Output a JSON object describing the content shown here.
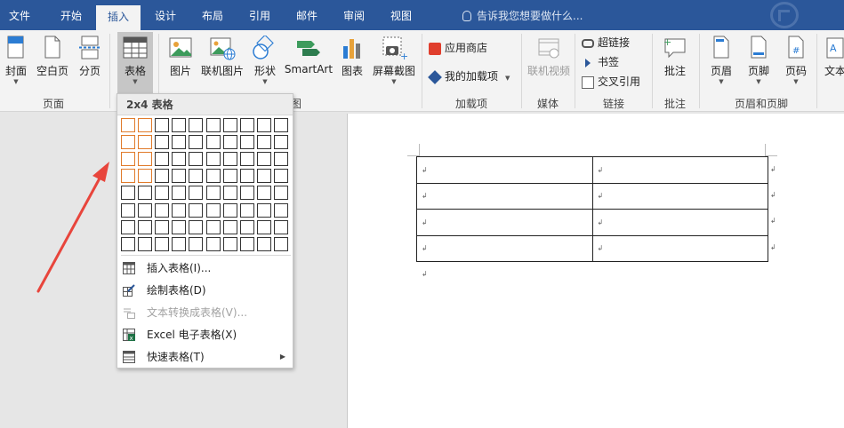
{
  "tabs": [
    "文件",
    "开始",
    "插入",
    "设计",
    "布局",
    "引用",
    "邮件",
    "审阅",
    "视图"
  ],
  "active_tab": "插入",
  "tell_me_placeholder": "告诉我您想要做什么...",
  "ribbon": {
    "pages_group": {
      "label": "页面",
      "cover": "封面",
      "blank_page": "空白页",
      "page_break": "分页"
    },
    "table_button": "表格",
    "illustrations": {
      "picture": "图片",
      "online_picture": "联机图片",
      "shapes": "形状",
      "smartart": "SmartArt",
      "chart": "图表",
      "screenshot": "屏幕截图",
      "group_label_tail": "图"
    },
    "addins": {
      "label": "加载项",
      "store": "应用商店",
      "my_addins": "我的加载项"
    },
    "media": {
      "label": "媒体",
      "online_video": "联机视频"
    },
    "links": {
      "label": "链接",
      "hyperlink": "超链接",
      "bookmark": "书签",
      "cross_ref": "交叉引用"
    },
    "comments": {
      "label": "批注",
      "comment": "批注"
    },
    "header_footer": {
      "label": "页眉和页脚",
      "header": "页眉",
      "footer": "页脚",
      "page_number": "页码"
    },
    "text_box": "文本"
  },
  "table_dropdown": {
    "header": "2x4 表格",
    "selected_cols": 2,
    "selected_rows": 4,
    "grid_cols": 10,
    "grid_rows": 8,
    "items": [
      {
        "label": "插入表格(I)...",
        "disabled": false
      },
      {
        "label": "绘制表格(D)",
        "disabled": false
      },
      {
        "label": "文本转换成表格(V)...",
        "disabled": true
      },
      {
        "label": "Excel 电子表格(X)",
        "disabled": false
      },
      {
        "label": "快速表格(T)",
        "disabled": false
      }
    ]
  },
  "document": {
    "table_rows": 4,
    "table_cols": 2,
    "cell_mark": "↲",
    "para_mark": "↲"
  },
  "colors": {
    "accent": "#2b579a",
    "selection": "#e07b2b",
    "annotation_arrow": "#e8453c"
  }
}
